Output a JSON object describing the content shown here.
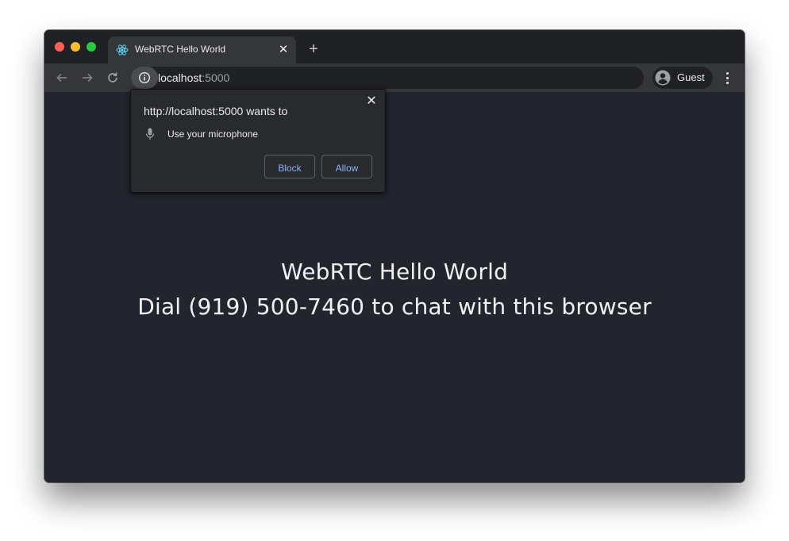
{
  "colors": {
    "page_background": "#23252e",
    "link_accent": "#8ab4f8"
  },
  "tab": {
    "title": "WebRTC Hello World",
    "favicon": "react-logo-icon",
    "close_icon": "close-icon"
  },
  "toolbar": {
    "new_tab_icon": "plus-icon",
    "back_icon": "arrow-left-icon",
    "forward_icon": "arrow-right-icon",
    "reload_icon": "reload-icon",
    "site_info_icon": "info-icon",
    "menu_icon": "kebab-menu-icon"
  },
  "address_bar": {
    "host": "localhost",
    "port": ":5000"
  },
  "profile": {
    "label": "Guest",
    "icon": "person-avatar-icon"
  },
  "permission_popup": {
    "title": "http://localhost:5000 wants to",
    "permission": "Use your microphone",
    "permission_icon": "microphone-icon",
    "block_label": "Block",
    "allow_label": "Allow"
  },
  "page": {
    "heading": "WebRTC Hello World",
    "subheading": "Dial (919) 500-7460 to chat with this browser"
  }
}
